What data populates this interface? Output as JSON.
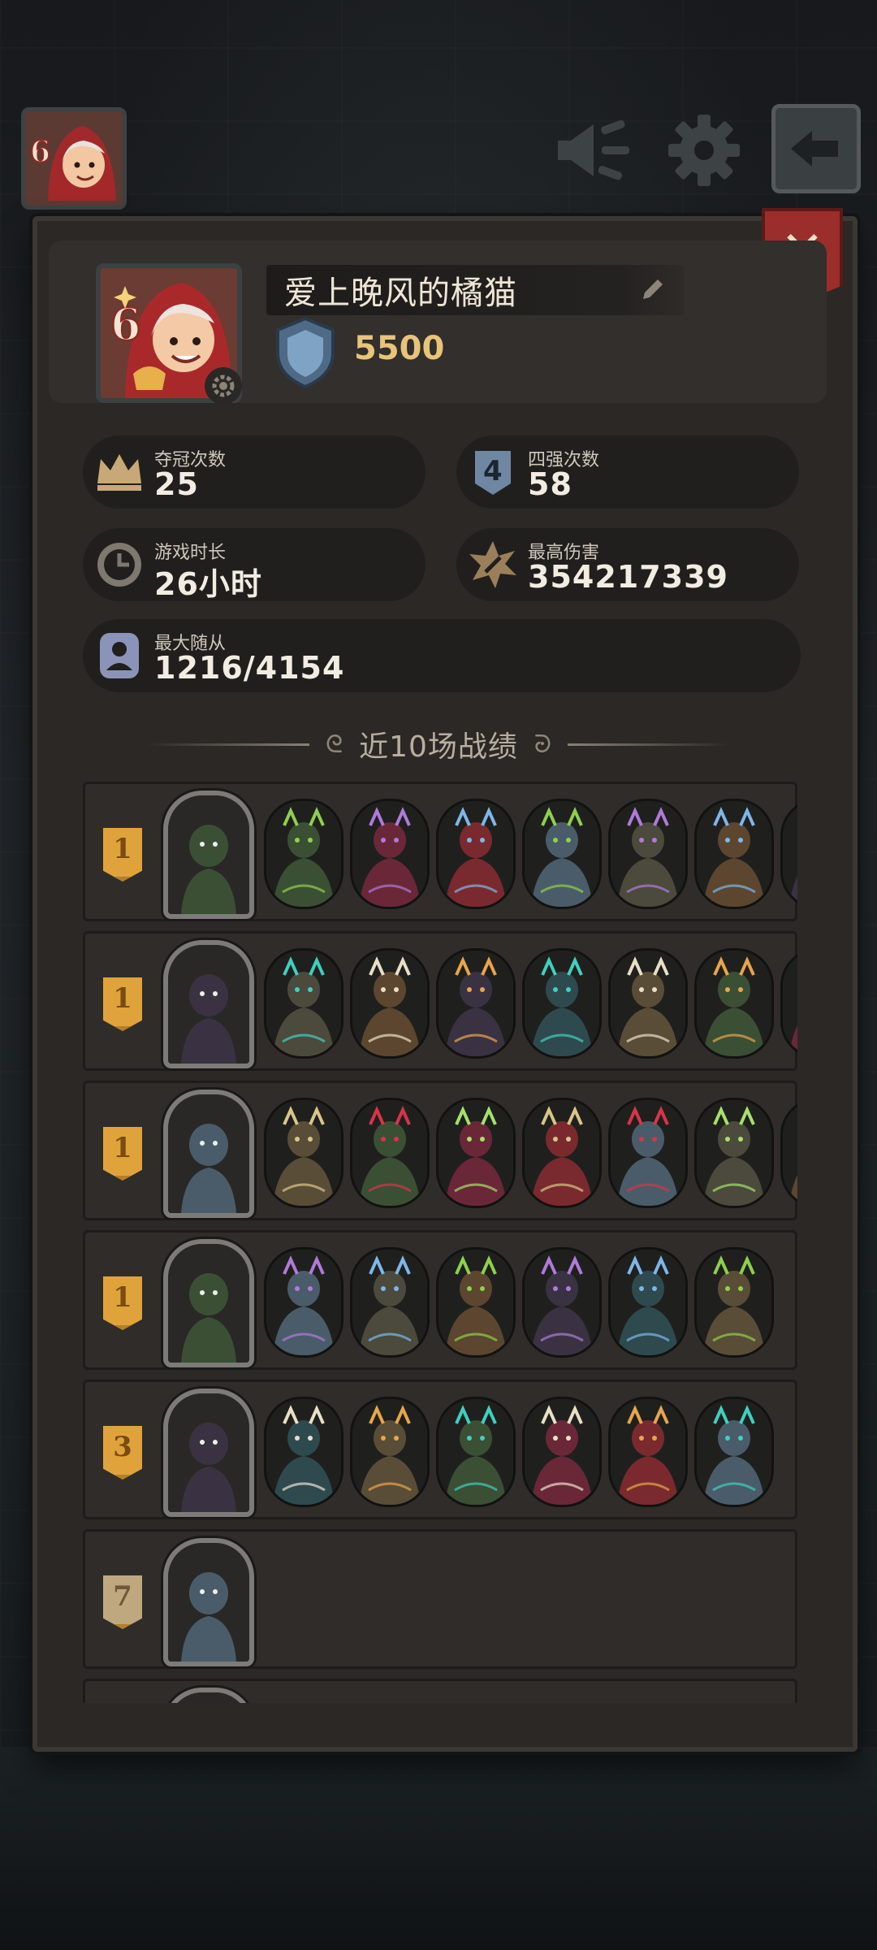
{
  "profile": {
    "name": "爱上晚风的橘猫",
    "avatar_level": "6",
    "rating": "5500"
  },
  "stats": {
    "champion": {
      "label": "夺冠次数",
      "value": "25"
    },
    "top4": {
      "label": "四强次数",
      "value": "58",
      "icon_text": "4"
    },
    "playtime": {
      "label": "游戏时长",
      "value": "26小时"
    },
    "max_damage": {
      "label": "最高伤害",
      "value": "354217339"
    },
    "max_minions": {
      "label": "最大随从",
      "value": "1216/4154"
    }
  },
  "recent_title": "近10场战绩",
  "icons": {
    "sound": "megaphone-icon",
    "settings": "gear-icon",
    "exit": "exit-arrow-icon",
    "close": "close-icon",
    "edit": "pencil-icon",
    "rank": "shield-rank-icon",
    "champion": "crown-icon",
    "top4": "badge-4-icon",
    "playtime": "clock-icon",
    "damage": "explosion-icon",
    "minions": "person-icon"
  },
  "colors": {
    "gold": "#e0a33b",
    "close_red": "#9b2d2a",
    "rating_gold": "#e8c47a",
    "panel": "#2b2826"
  },
  "matches": [
    {
      "place": "1",
      "minions": 7
    },
    {
      "place": "1",
      "minions": 7
    },
    {
      "place": "1",
      "minions": 7
    },
    {
      "place": "1",
      "minions": 6
    },
    {
      "place": "3",
      "minions": 6
    },
    {
      "place": "7",
      "minions": 0
    },
    {
      "place": "",
      "minions": 0
    }
  ]
}
